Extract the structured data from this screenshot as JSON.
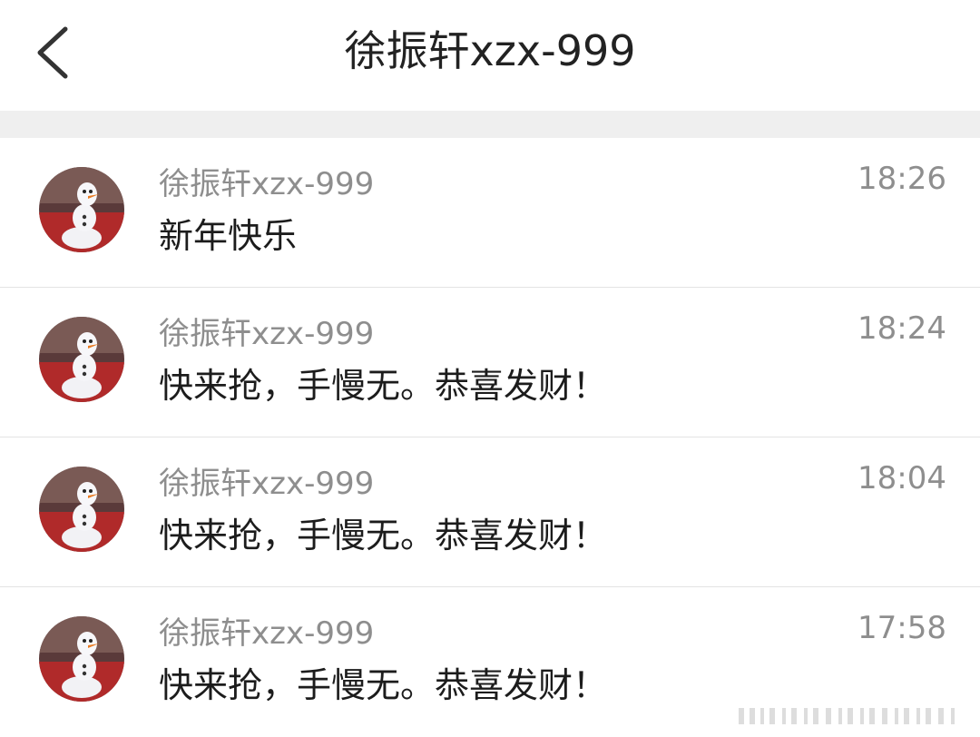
{
  "header": {
    "title": "徐振轩xzx-999",
    "back_icon": "chevron-left-icon"
  },
  "messages": [
    {
      "sender": "徐振轩xzx-999",
      "text": "新年快乐",
      "time": "18:26"
    },
    {
      "sender": "徐振轩xzx-999",
      "text": "快来抢，手慢无。恭喜发财！",
      "time": "18:24"
    },
    {
      "sender": "徐振轩xzx-999",
      "text": "快来抢，手慢无。恭喜发财！",
      "time": "18:04"
    },
    {
      "sender": "徐振轩xzx-999",
      "text": "快来抢，手慢无。恭喜发财！",
      "time": "17:58"
    }
  ],
  "colors": {
    "background": "#ffffff",
    "band": "#efefef",
    "secondary_text": "#8e8e8e",
    "primary_text": "#1c1c1c"
  }
}
